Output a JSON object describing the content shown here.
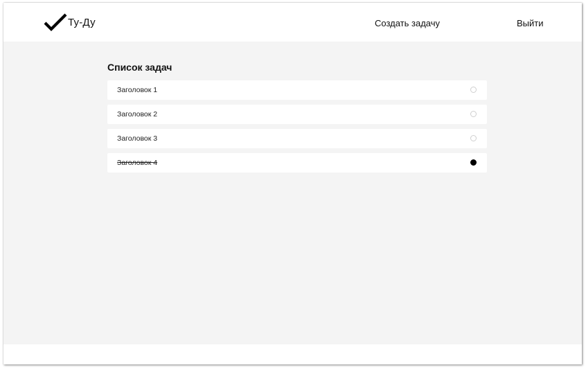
{
  "header": {
    "logo_text": "Ту-Ду",
    "create_task_label": "Создать задачу",
    "logout_label": "Выйти"
  },
  "main": {
    "list_title": "Список задач",
    "tasks": [
      {
        "title": "Заголовок 1",
        "done": false
      },
      {
        "title": "Заголовок 2",
        "done": false
      },
      {
        "title": "Заголовок 3",
        "done": false
      },
      {
        "title": "Заголовок 4",
        "done": true
      }
    ]
  },
  "colors": {
    "background": "#f4f4f4",
    "surface": "#ffffff",
    "text": "#111111",
    "checked": "#000000",
    "unchecked_border": "#cfcfcf"
  },
  "icons": {
    "logo": "checkmark-icon"
  }
}
